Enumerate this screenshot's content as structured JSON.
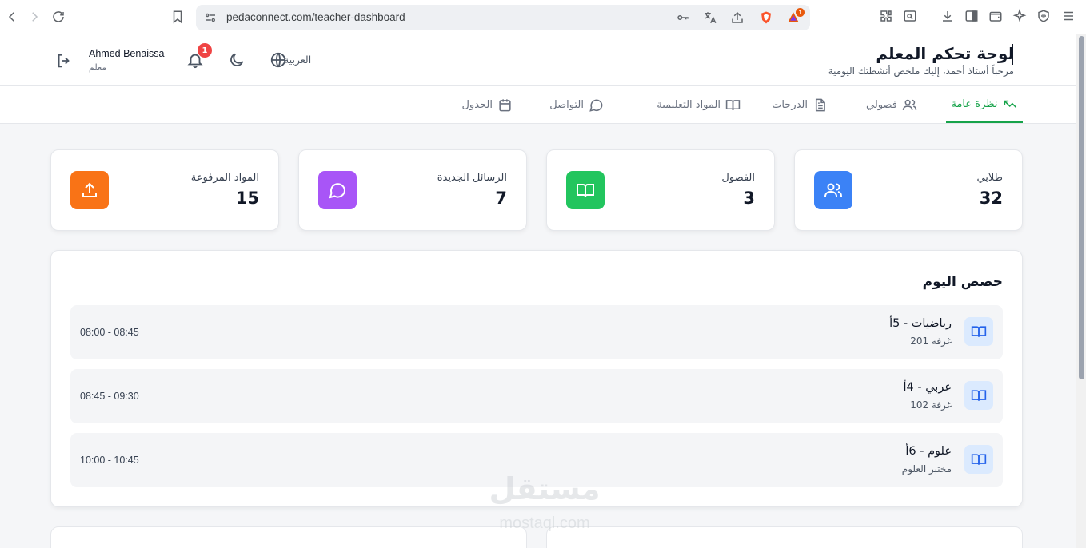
{
  "browser": {
    "url": "pedaconnect.com/teacher-dashboard",
    "brave_badge_count": "1"
  },
  "header": {
    "title": "لوحة تحكم المعلم",
    "subtitle": "مرحباً أستاذ أحمد، إليك ملخص أنشطتك اليومية",
    "user_name": "Ahmed Benaissa",
    "user_role": "معلم",
    "notification_count": "1",
    "language_label": "العربية"
  },
  "tabs": [
    {
      "label": "نظرة عامة",
      "icon": "trending-up-icon",
      "active": true
    },
    {
      "label": "فصولي",
      "icon": "users-icon",
      "active": false
    },
    {
      "label": "الدرجات",
      "icon": "file-text-icon",
      "active": false
    },
    {
      "label": "المواد التعليمية",
      "icon": "book-open-icon",
      "active": false
    },
    {
      "label": "التواصل",
      "icon": "message-circle-icon",
      "active": false
    },
    {
      "label": "الجدول",
      "icon": "calendar-icon",
      "active": false
    }
  ],
  "stats": [
    {
      "label": "طلابي",
      "value": "32",
      "icon": "users-icon",
      "color": "#3b82f6"
    },
    {
      "label": "الفصول",
      "value": "3",
      "icon": "book-open-icon",
      "color": "#22c55e"
    },
    {
      "label": "الرسائل الجديدة",
      "value": "7",
      "icon": "message-circle-icon",
      "color": "#a855f7"
    },
    {
      "label": "المواد المرفوعة",
      "value": "15",
      "icon": "upload-icon",
      "color": "#f97316"
    }
  ],
  "today_classes": {
    "title": "حصص اليوم",
    "items": [
      {
        "name": "رياضيات - 5أ",
        "room": "غرفة 201",
        "time": "08:00 - 08:45"
      },
      {
        "name": "عربي - 4أ",
        "room": "غرفة 102",
        "time": "08:45 - 09:30"
      },
      {
        "name": "علوم - 6أ",
        "room": "مختبر العلوم",
        "time": "10:00 - 10:45"
      }
    ]
  },
  "watermark": {
    "main": "مستقل",
    "sub": "mostaql.com"
  }
}
